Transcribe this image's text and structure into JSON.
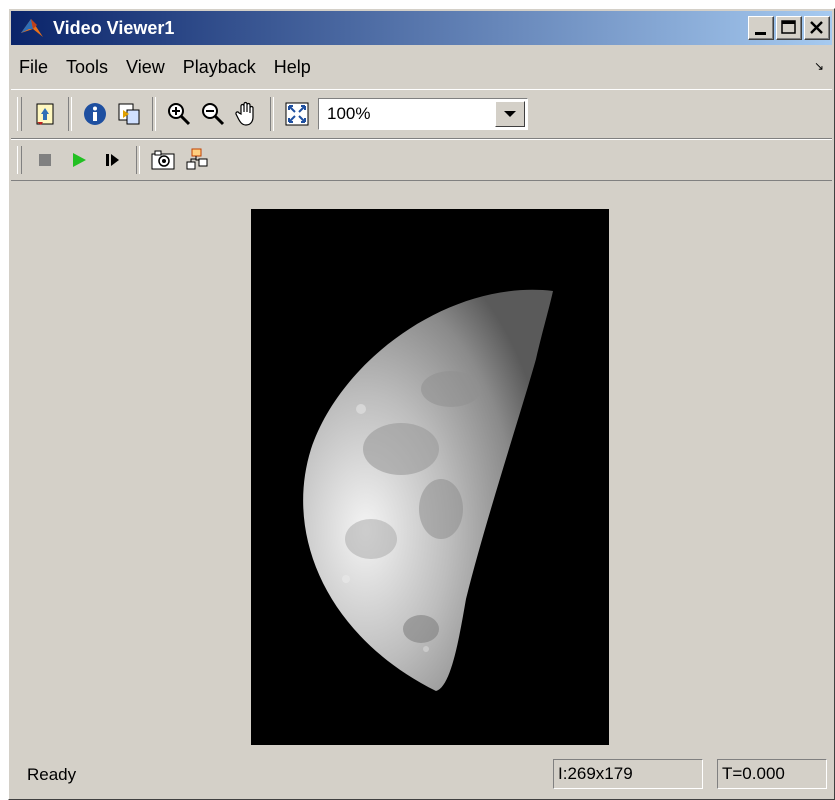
{
  "window": {
    "title": "Video Viewer1",
    "controls": [
      "minimize",
      "maximize",
      "close"
    ]
  },
  "menu": {
    "items": [
      "File",
      "Tools",
      "View",
      "Playback",
      "Help"
    ]
  },
  "toolbar": {
    "buttons": [
      "open-in-editor-icon",
      "info-icon",
      "export-icon",
      "zoom-in-icon",
      "zoom-out-icon",
      "pan-hand-icon",
      "fit-to-view-icon"
    ],
    "zoom_value": "100%"
  },
  "playback": {
    "buttons": [
      "stop-icon",
      "play-icon",
      "step-forward-icon",
      "snapshot-icon",
      "highlight-block-icon"
    ]
  },
  "status": {
    "text": "Ready",
    "image_info": "I:269x179",
    "time": "T=0.000"
  }
}
